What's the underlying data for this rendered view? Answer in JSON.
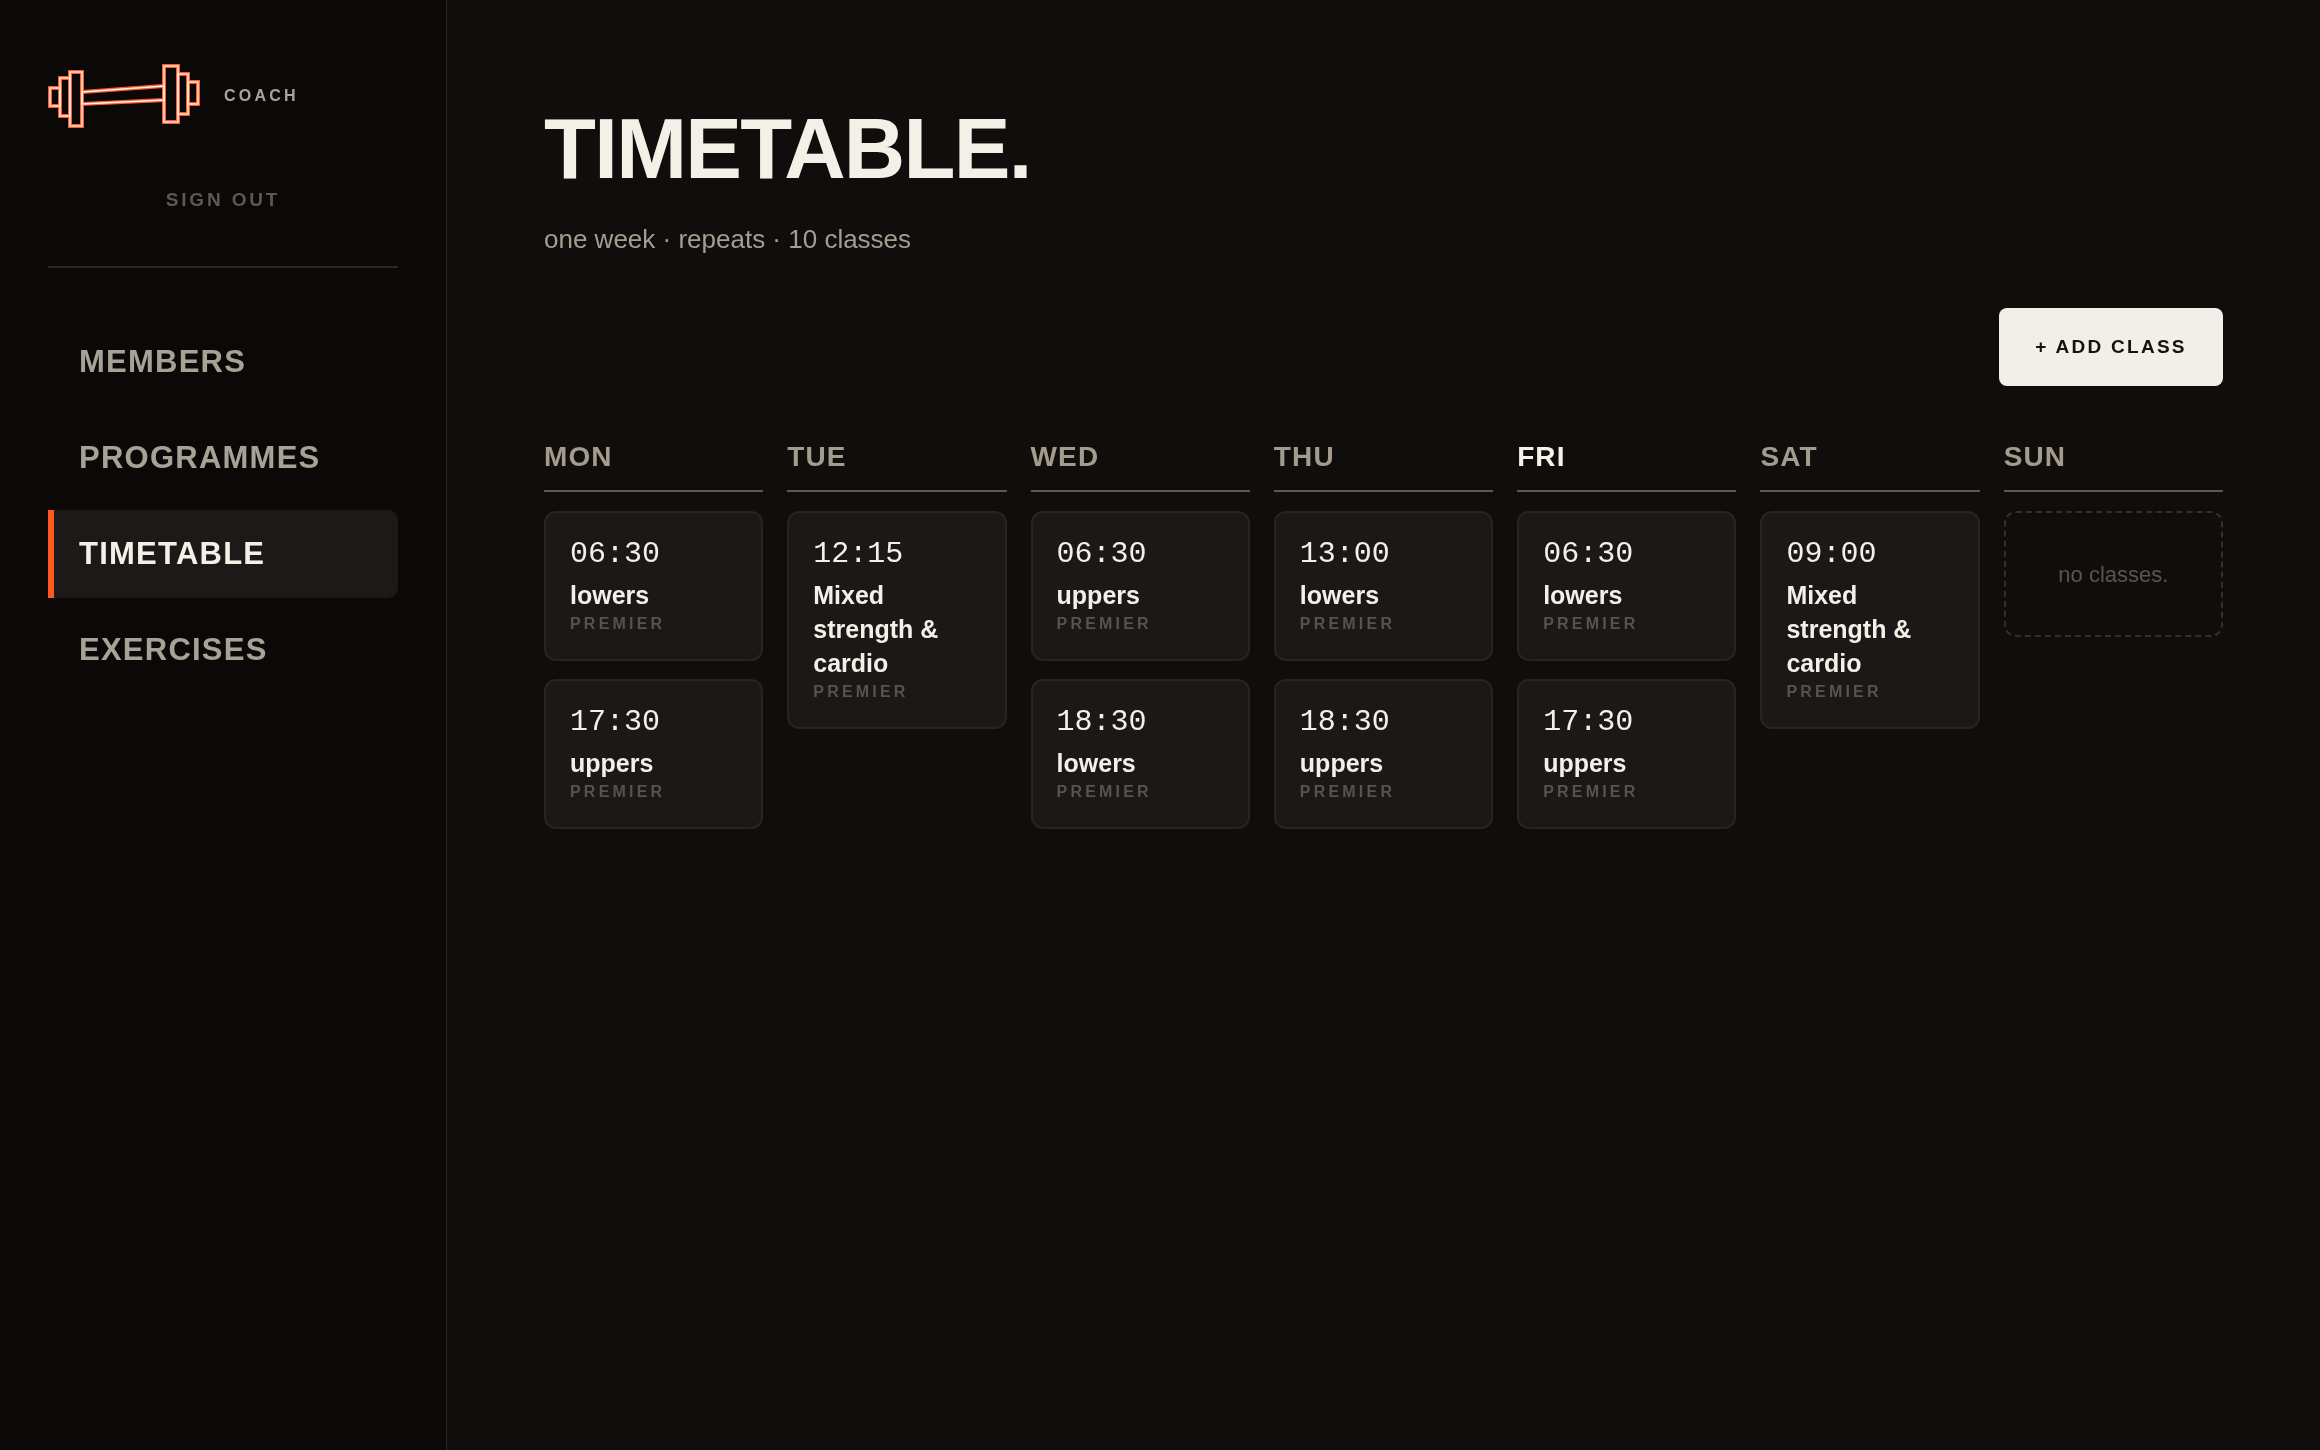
{
  "brand": {
    "label": "COACH"
  },
  "sign_out": "SIGN OUT",
  "nav": [
    {
      "label": "MEMBERS",
      "selected": false
    },
    {
      "label": "PROGRAMMES",
      "selected": false
    },
    {
      "label": "TIMETABLE",
      "selected": true
    },
    {
      "label": "EXERCISES",
      "selected": false
    }
  ],
  "page": {
    "title": "TIMETABLE.",
    "subtitle": "one week · repeats · 10 classes"
  },
  "add_button": "+ ADD CLASS",
  "days": [
    {
      "label": "MON",
      "today": false,
      "classes": [
        {
          "time": "06:30",
          "name": "lowers",
          "tier": "PREMIER"
        },
        {
          "time": "17:30",
          "name": "uppers",
          "tier": "PREMIER"
        }
      ]
    },
    {
      "label": "TUE",
      "today": false,
      "classes": [
        {
          "time": "12:15",
          "name": "Mixed strength & cardio",
          "tier": "PREMIER"
        }
      ]
    },
    {
      "label": "WED",
      "today": false,
      "classes": [
        {
          "time": "06:30",
          "name": "uppers",
          "tier": "PREMIER"
        },
        {
          "time": "18:30",
          "name": "lowers",
          "tier": "PREMIER"
        }
      ]
    },
    {
      "label": "THU",
      "today": false,
      "classes": [
        {
          "time": "13:00",
          "name": "lowers",
          "tier": "PREMIER"
        },
        {
          "time": "18:30",
          "name": "uppers",
          "tier": "PREMIER"
        }
      ]
    },
    {
      "label": "FRI",
      "today": true,
      "classes": [
        {
          "time": "06:30",
          "name": "lowers",
          "tier": "PREMIER"
        },
        {
          "time": "17:30",
          "name": "uppers",
          "tier": "PREMIER"
        }
      ]
    },
    {
      "label": "SAT",
      "today": false,
      "classes": [
        {
          "time": "09:00",
          "name": "Mixed strength & cardio",
          "tier": "PREMIER"
        }
      ]
    },
    {
      "label": "SUN",
      "today": false,
      "empty_text": "no classes."
    }
  ]
}
